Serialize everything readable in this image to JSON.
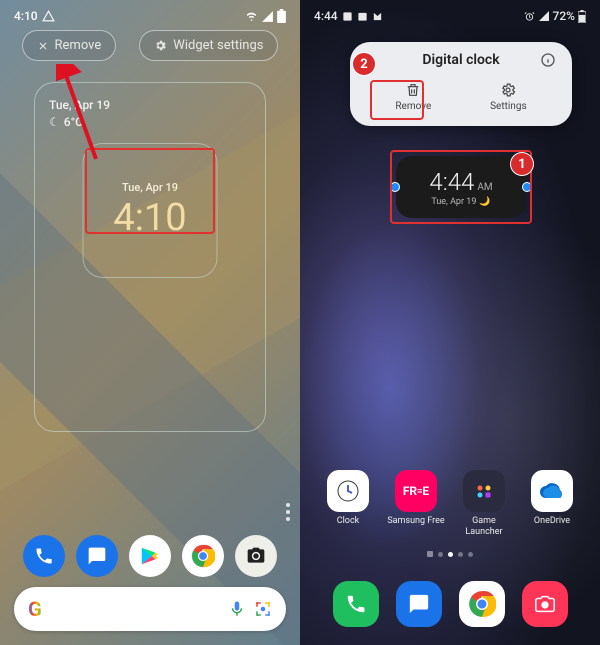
{
  "left": {
    "status": {
      "time": "4:10",
      "icons": [
        "dnd"
      ],
      "right_icons": [
        "wifi",
        "signal",
        "battery"
      ]
    },
    "actions": {
      "remove": "Remove",
      "settings": "Widget settings"
    },
    "home_widget": {
      "date": "Tue, Apr 19",
      "temp": "6°C",
      "phase_icon": "moon"
    },
    "clock_widget": {
      "date": "Tue, Apr 19",
      "time": "4:10"
    },
    "dock": [
      "phone",
      "messages",
      "play",
      "chrome",
      "camera"
    ],
    "search": {
      "left_logo": "G",
      "placeholder": ""
    }
  },
  "right": {
    "status": {
      "time": "4:44",
      "notif_icons": [
        "image",
        "calendar",
        "mail"
      ],
      "right_icons": [
        "alarm",
        "signal",
        "battery"
      ],
      "battery_pct": "72%"
    },
    "popup": {
      "title": "Digital clock",
      "remove": "Remove",
      "settings": "Settings"
    },
    "clock_widget": {
      "time": "4:44",
      "ampm": "AM",
      "date": "Tue, Apr 19",
      "phase_icon": "moon"
    },
    "badges": {
      "widget": "1",
      "remove": "2"
    },
    "apps": [
      {
        "label": "Clock",
        "key": "clock"
      },
      {
        "label": "Samsung Free",
        "key": "samsung-free"
      },
      {
        "label": "Game Launcher",
        "key": "game-launcher"
      },
      {
        "label": "OneDrive",
        "key": "onedrive"
      }
    ],
    "nav": [
      "phone",
      "messages",
      "chrome",
      "camera"
    ]
  }
}
